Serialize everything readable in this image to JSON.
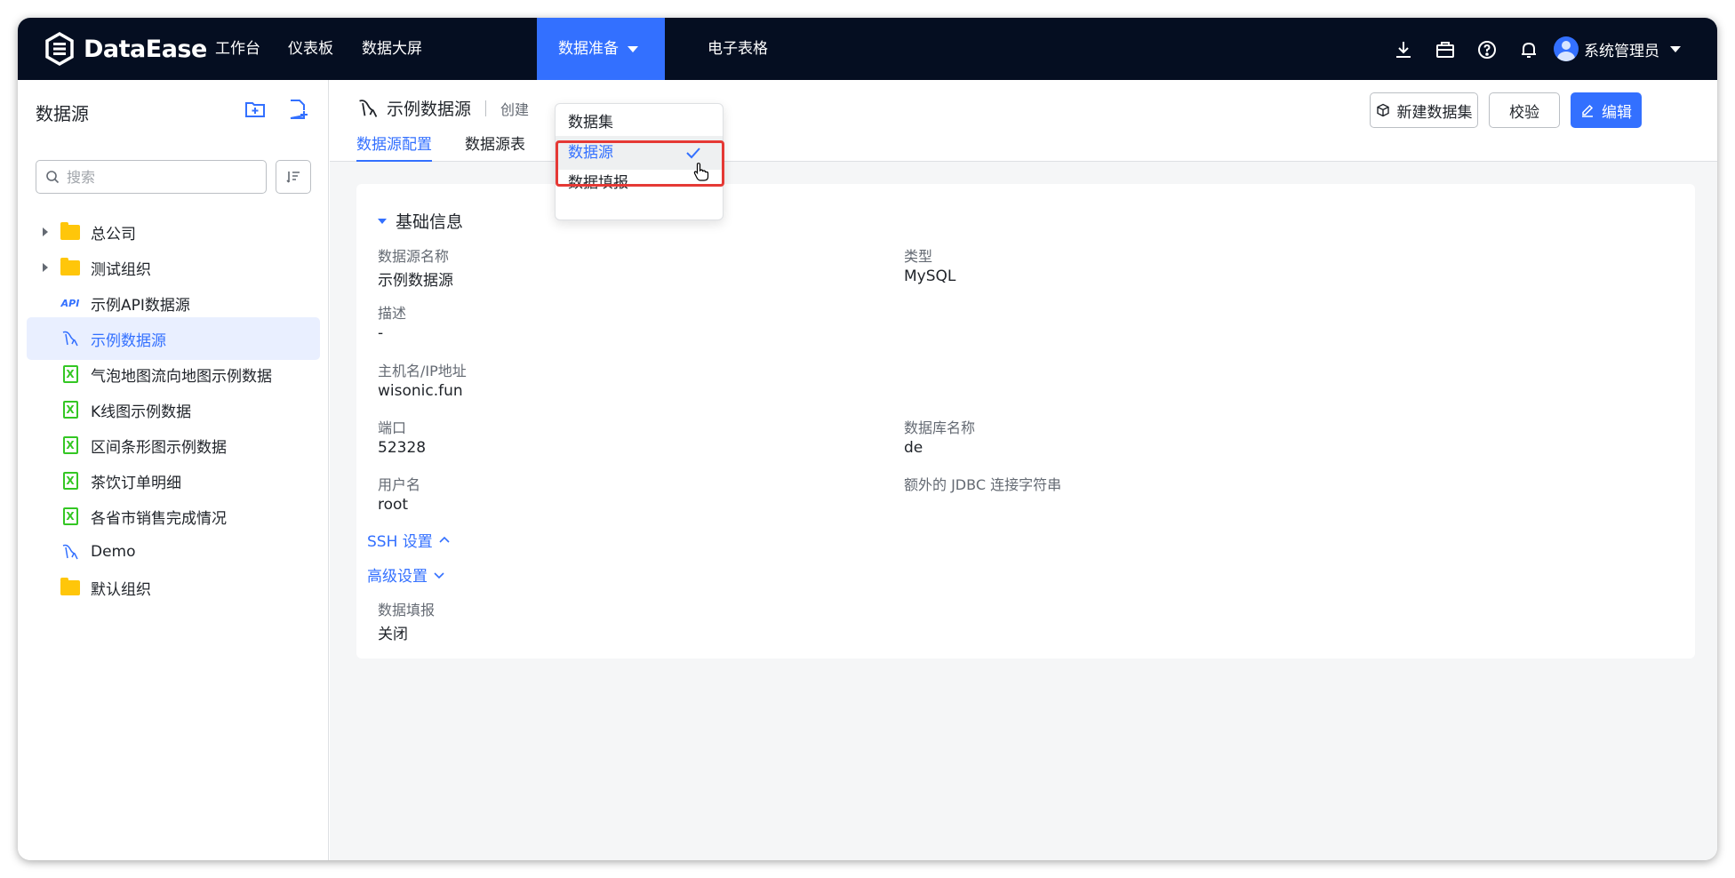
{
  "app": {
    "brand": "DataEase",
    "nav": [
      {
        "label": "工作台"
      },
      {
        "label": "仪表板"
      },
      {
        "label": "数据大屏"
      },
      {
        "label": "数据准备"
      },
      {
        "label": "电子表格"
      }
    ],
    "user_name": "系统管理员",
    "accent_color": "#3370ff",
    "topbar_color": "#050e21",
    "top_icons": [
      "download-icon",
      "briefcase-icon",
      "help-icon",
      "bell-icon"
    ]
  },
  "dropdown": {
    "items": [
      {
        "label": "数据集"
      },
      {
        "label": "数据源"
      },
      {
        "label": "数据填报"
      }
    ]
  },
  "sidebar": {
    "title": "数据源",
    "search_placeholder": "搜索",
    "items": [
      {
        "label": "总公司"
      },
      {
        "label": "测试组织"
      },
      {
        "label": "示例API数据源",
        "icon_text": "API"
      },
      {
        "label": "示例数据源"
      },
      {
        "label": "气泡地图流向地图示例数据",
        "icon_text": "X"
      },
      {
        "label": "K线图示例数据",
        "icon_text": "X"
      },
      {
        "label": "区间条形图示例数据",
        "icon_text": "X"
      },
      {
        "label": "茶饮订单明细",
        "icon_text": "X"
      },
      {
        "label": "各省市销售完成情况",
        "icon_text": "X"
      },
      {
        "label": "Demo"
      },
      {
        "label": "默认组织"
      }
    ]
  },
  "main": {
    "title": "示例数据源",
    "meta": "创建",
    "tabs": [
      {
        "label": "数据源配置"
      },
      {
        "label": "数据源表"
      }
    ],
    "buttons": {
      "new_dataset": "新建数据集",
      "verify": "校验",
      "edit": "编辑"
    },
    "section_title": "基础信息",
    "fields": {
      "name_label": "数据源名称",
      "name_value": "示例数据源",
      "type_label": "类型",
      "type_value": "MySQL",
      "desc_label": "描述",
      "desc_value": "-",
      "host_label": "主机名/IP地址",
      "host_value": "wisonic.fun",
      "port_label": "端口",
      "port_value": "52328",
      "db_label": "数据库名称",
      "db_value": "de",
      "user_label": "用户名",
      "user_value": "root",
      "jdbc_label": "额外的 JDBC 连接字符串",
      "fill_label": "数据填报",
      "fill_value": "关闭"
    },
    "ssh_link": "SSH 设置",
    "advanced_link": "高级设置"
  }
}
